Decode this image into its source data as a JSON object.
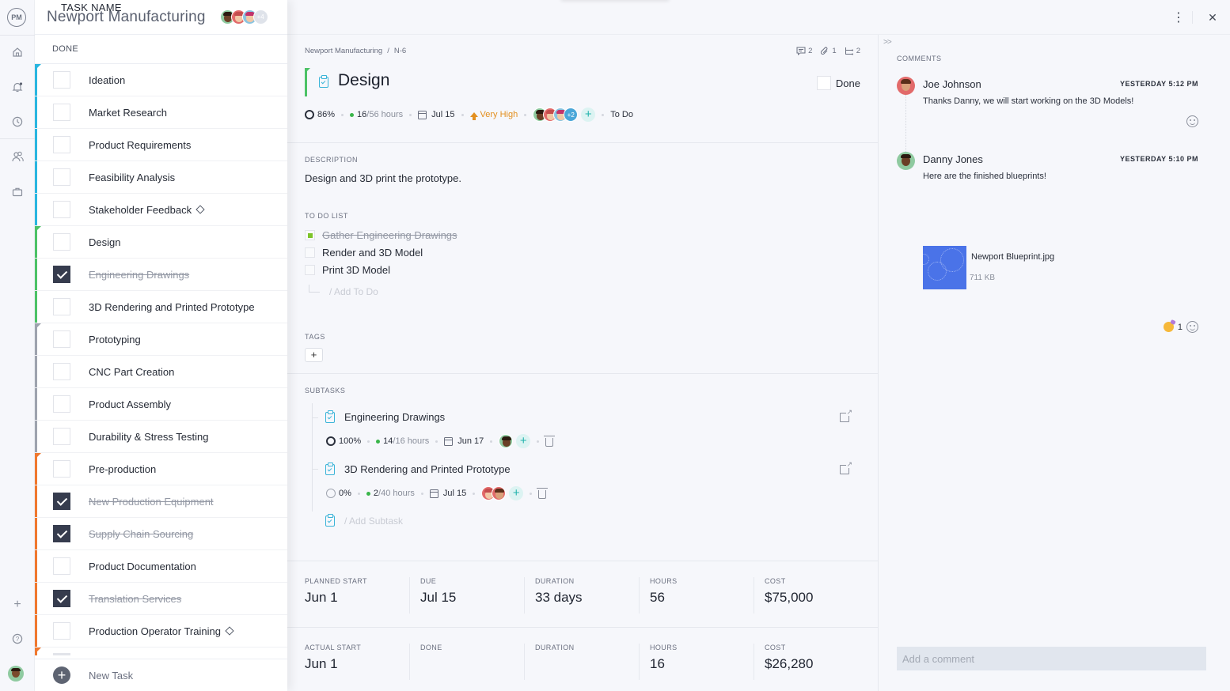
{
  "rail": {
    "logo": "PM",
    "icons": [
      "home-icon",
      "notification-bell-icon",
      "clock-icon",
      "people-icon",
      "briefcase-icon",
      "plus-icon",
      "help-icon"
    ]
  },
  "project": {
    "title": "Newport Manufacturing",
    "members_more": "+4"
  },
  "task_list": {
    "col_done": "DONE",
    "col_name": "TASK NAME",
    "new_task_label": "New Task",
    "colors": {
      "cyan": "#29b6e0",
      "green": "#4cc266",
      "gray": "#9ea3ae",
      "orange": "#f0782e"
    },
    "tasks": [
      {
        "name": "Ideation",
        "done": false,
        "group": "cyan",
        "flag": true,
        "milestone": false
      },
      {
        "name": "Market Research",
        "done": false,
        "group": "cyan",
        "flag": false,
        "milestone": false
      },
      {
        "name": "Product Requirements",
        "done": false,
        "group": "cyan",
        "flag": false,
        "milestone": false
      },
      {
        "name": "Feasibility Analysis",
        "done": false,
        "group": "cyan",
        "flag": false,
        "milestone": false
      },
      {
        "name": "Stakeholder Feedback",
        "done": false,
        "group": "cyan",
        "flag": false,
        "milestone": true
      },
      {
        "name": "Design",
        "done": false,
        "group": "green",
        "flag": true,
        "milestone": false
      },
      {
        "name": "Engineering Drawings",
        "done": true,
        "group": "green",
        "flag": false,
        "milestone": false
      },
      {
        "name": "3D Rendering and Printed Prototype",
        "done": false,
        "group": "green",
        "flag": false,
        "milestone": false
      },
      {
        "name": "Prototyping",
        "done": false,
        "group": "gray",
        "flag": true,
        "milestone": false
      },
      {
        "name": "CNC Part Creation",
        "done": false,
        "group": "gray",
        "flag": false,
        "milestone": false
      },
      {
        "name": "Product Assembly",
        "done": false,
        "group": "gray",
        "flag": false,
        "milestone": false
      },
      {
        "name": "Durability & Stress Testing",
        "done": false,
        "group": "gray",
        "flag": false,
        "milestone": false
      },
      {
        "name": "Pre-production",
        "done": false,
        "group": "orange",
        "flag": true,
        "milestone": false
      },
      {
        "name": "New Production Equipment",
        "done": true,
        "group": "orange",
        "flag": false,
        "milestone": false
      },
      {
        "name": "Supply Chain Sourcing",
        "done": true,
        "group": "orange",
        "flag": false,
        "milestone": false
      },
      {
        "name": "Product Documentation",
        "done": false,
        "group": "orange",
        "flag": false,
        "milestone": false
      },
      {
        "name": "Translation Services",
        "done": true,
        "group": "orange",
        "flag": false,
        "milestone": false
      },
      {
        "name": "Production Operator Training",
        "done": false,
        "group": "orange",
        "flag": false,
        "milestone": true
      }
    ]
  },
  "detail": {
    "breadcrumb": {
      "project": "Newport Manufacturing",
      "separator": "/",
      "id": "N-6"
    },
    "counts": {
      "comments": "2",
      "attachments": "1",
      "subtasks": "2"
    },
    "title": "Design",
    "done_label": "Done",
    "done_checked": false,
    "meta": {
      "progress": "86%",
      "hours_logged": "16",
      "hours_total": "/56 hours",
      "due": "Jul 15",
      "priority": "Very High",
      "assignees_more": "+2",
      "status": "To Do"
    },
    "description_label": "DESCRIPTION",
    "description": "Design and 3D print the prototype.",
    "todo_label": "TO DO LIST",
    "todos": [
      {
        "text": "Gather Engineering Drawings",
        "done": true
      },
      {
        "text": "Render and 3D Model",
        "done": false
      },
      {
        "text": "Print 3D Model",
        "done": false
      }
    ],
    "add_todo_placeholder": "/ Add To Do",
    "tags_label": "TAGS",
    "tags_add": "+",
    "subtasks_label": "SUBTASKS",
    "subtasks": [
      {
        "name": "Engineering Drawings",
        "progress": "100%",
        "hours_logged": "14",
        "hours_total": "/16 hours",
        "due": "Jun 17"
      },
      {
        "name": "3D Rendering and Printed Prototype",
        "progress": "0%",
        "hours_logged": "2",
        "hours_total": "/40 hours",
        "due": "Jul 15"
      }
    ],
    "add_subtask_placeholder": "/ Add Subtask",
    "planned": [
      {
        "label": "PLANNED START",
        "value": "Jun 1"
      },
      {
        "label": "DUE",
        "value": "Jul 15"
      },
      {
        "label": "DURATION",
        "value": "33 days"
      },
      {
        "label": "HOURS",
        "value": "56"
      },
      {
        "label": "COST",
        "value": "$75,000"
      }
    ],
    "actual": [
      {
        "label": "ACTUAL START",
        "value": "Jun 1"
      },
      {
        "label": "DONE",
        "value": ""
      },
      {
        "label": "DURATION",
        "value": ""
      },
      {
        "label": "HOURS",
        "value": "16"
      },
      {
        "label": "COST",
        "value": "$26,280"
      }
    ]
  },
  "comments": {
    "collapse_glyph": ">>",
    "label": "COMMENTS",
    "items": [
      {
        "author": "Joe Johnson",
        "time": "YESTERDAY 5:12 PM",
        "text": "Thanks Danny, we will start working on the 3D Models!"
      },
      {
        "author": "Danny Jones",
        "time": "YESTERDAY 5:10 PM",
        "text": "Here are the finished blueprints!"
      }
    ],
    "attachment": {
      "name": "Newport Blueprint.jpg",
      "size": "711 KB"
    },
    "reaction_count": "1",
    "input_placeholder": "Add a comment"
  }
}
